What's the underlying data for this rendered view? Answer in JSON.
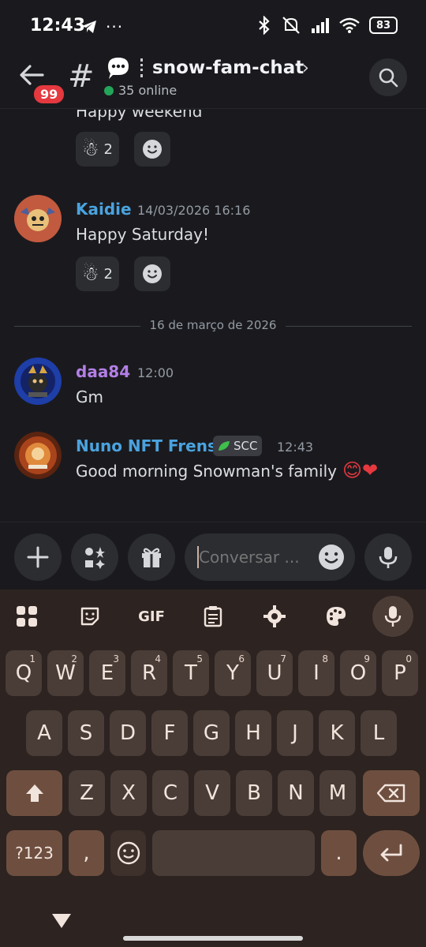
{
  "status_bar": {
    "time": "12:43",
    "battery": "83"
  },
  "header": {
    "badge": "99",
    "hash": "#",
    "channel_name": "snow-fam-chat",
    "chevron": "›",
    "online": "35 online"
  },
  "messages": {
    "partial_text": "Happy weekend",
    "partial_reaction_count": "2",
    "msg1": {
      "author": "Kaidie",
      "timestamp": "14/03/2026 16:16",
      "text": "Happy Saturday!",
      "reaction_count": "2"
    },
    "date_separator": "16 de março de 2026",
    "msg2": {
      "author": "daa84",
      "timestamp": "12:00",
      "text": "Gm"
    },
    "msg3": {
      "author": "Nuno NFT Frens",
      "tag": "SCC",
      "timestamp": "12:43",
      "text": "Good morning Snowman's family",
      "emoji": "😊❤"
    }
  },
  "composer": {
    "placeholder": "Conversar ..."
  },
  "keyboard": {
    "toolbar": {
      "gif": "GIF"
    },
    "row1": [
      {
        "k": "Q",
        "h": "1"
      },
      {
        "k": "W",
        "h": "2"
      },
      {
        "k": "E",
        "h": "3"
      },
      {
        "k": "R",
        "h": "4"
      },
      {
        "k": "T",
        "h": "5"
      },
      {
        "k": "Y",
        "h": "6"
      },
      {
        "k": "U",
        "h": "7"
      },
      {
        "k": "I",
        "h": "8"
      },
      {
        "k": "O",
        "h": "9"
      },
      {
        "k": "P",
        "h": "0"
      }
    ],
    "row2": [
      "A",
      "S",
      "D",
      "F",
      "G",
      "H",
      "J",
      "K",
      "L"
    ],
    "row3": [
      "Z",
      "X",
      "C",
      "V",
      "B",
      "N",
      "M"
    ],
    "sym_key": "?123",
    "comma": ",",
    "period": "."
  },
  "colors": {
    "accent_blue": "#4aa3df",
    "accent_purple": "#b37fe6",
    "online_green": "#23a55a",
    "badge_red": "#e5393f"
  }
}
